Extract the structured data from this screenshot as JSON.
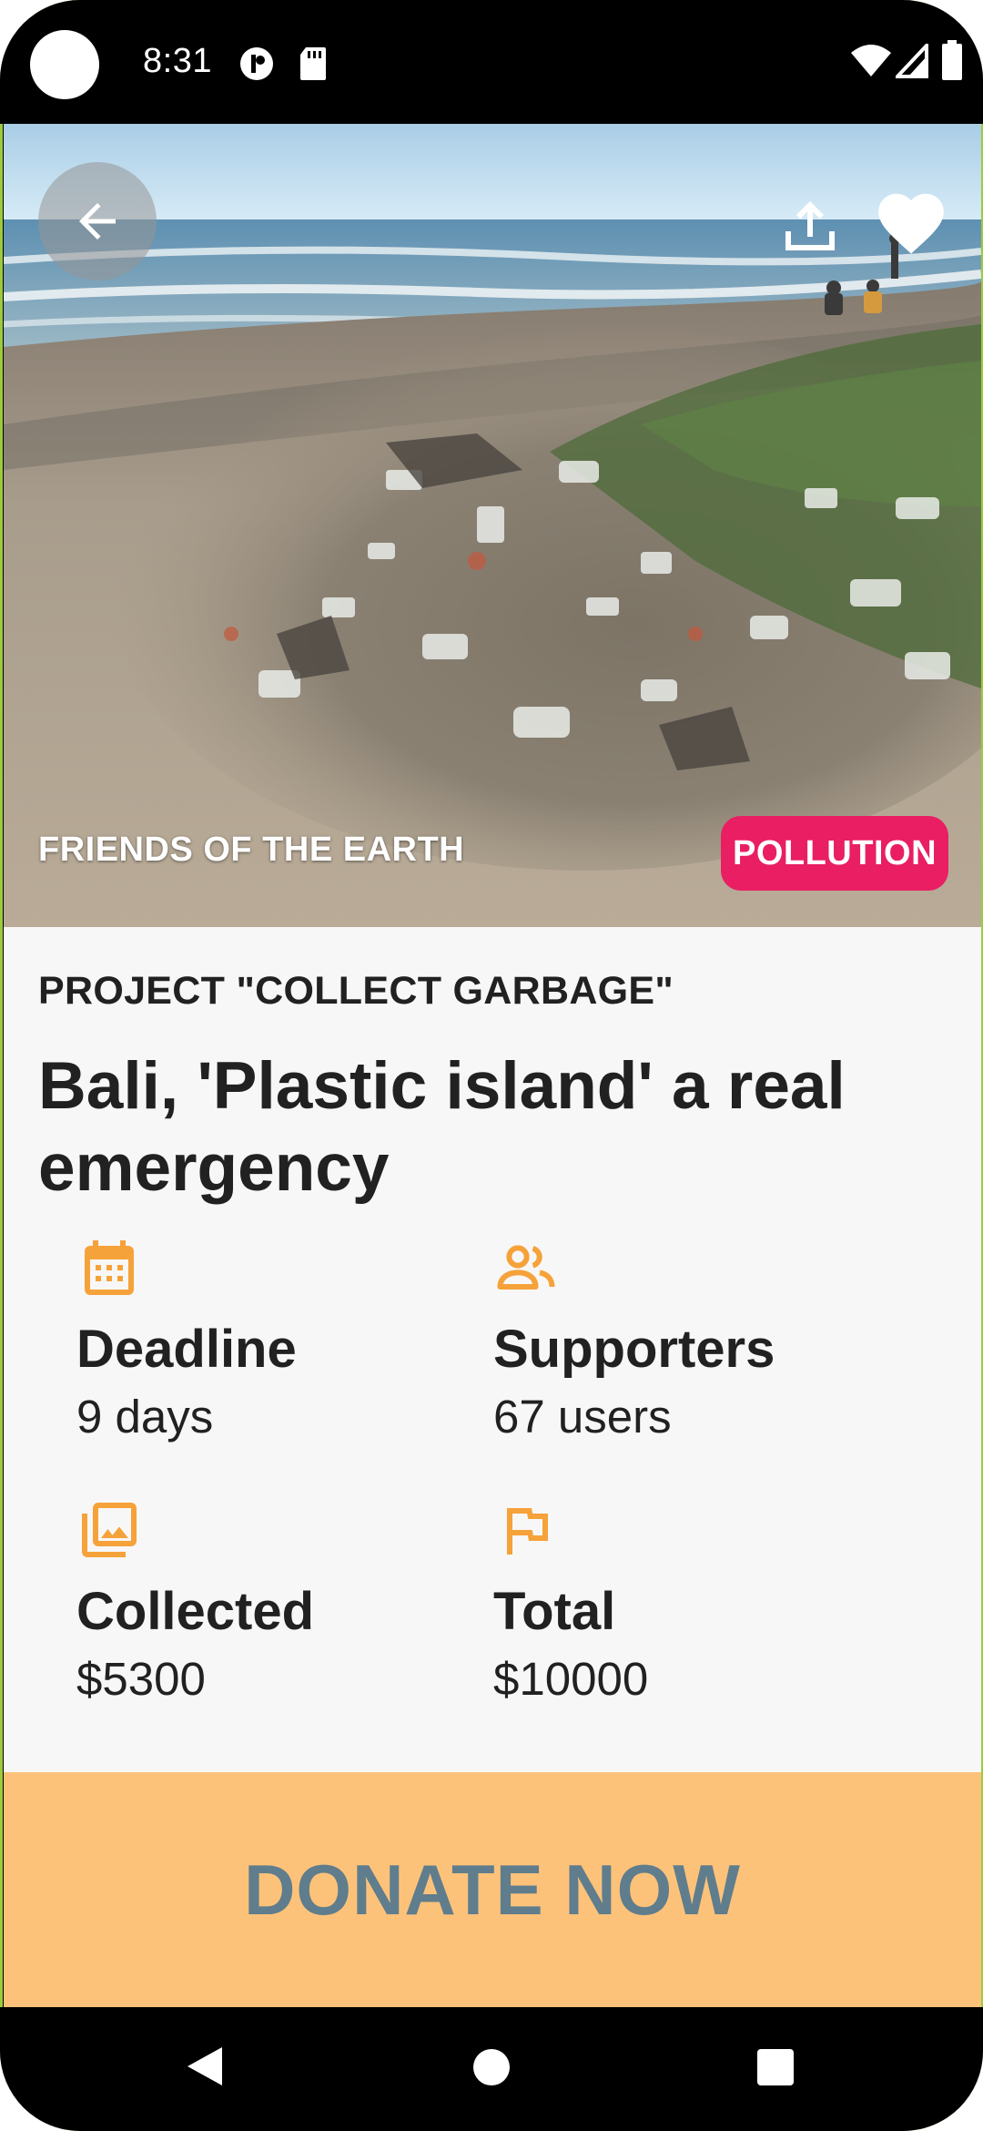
{
  "status_bar": {
    "time": "8:31",
    "icons": [
      "notification-icon",
      "sd-card-icon",
      "wifi-icon",
      "signal-icon",
      "battery-icon"
    ]
  },
  "hero": {
    "image_description_icon": "beach-garbage-photo",
    "organization": "FRIENDS OF THE EARTH",
    "category": "POLLUTION",
    "colors": {
      "category_badge": "#e91e63"
    }
  },
  "project": {
    "label": "PROJECT \"COLLECT GARBAGE\"",
    "title": "Bali, 'Plastic island' a real emergency"
  },
  "stats": {
    "deadline": {
      "icon": "calendar-icon",
      "title": "Deadline",
      "value": "9 days"
    },
    "supporters": {
      "icon": "people-icon",
      "title": "Supporters",
      "value": "67 users"
    },
    "collected": {
      "icon": "photo-library-icon",
      "title": "Collected",
      "value": "$5300"
    },
    "total": {
      "icon": "flag-icon",
      "title": "Total",
      "value": "$10000"
    }
  },
  "donate": {
    "label": "DONATE NOW",
    "colors": {
      "background": "#fdc27a",
      "text": "#5f7d8c"
    }
  },
  "accent_color": "#f6a23a",
  "nav_bar": {
    "buttons": [
      "back-triangle-icon",
      "home-circle-icon",
      "recents-square-icon"
    ]
  }
}
